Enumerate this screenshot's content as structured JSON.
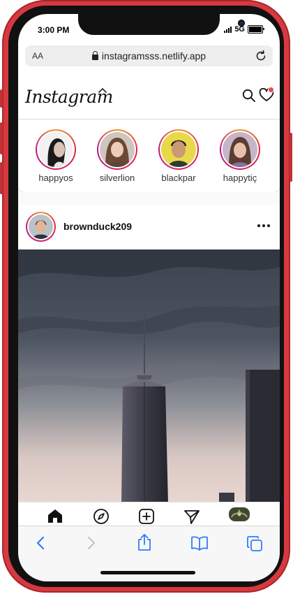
{
  "status_bar": {
    "time": "3:00 PM",
    "network": "5G"
  },
  "browser": {
    "text_size_label": "AA",
    "url": "instagramsss.netlify.app"
  },
  "header": {
    "logo_text": "Instagram"
  },
  "stories": [
    {
      "username": "happyos"
    },
    {
      "username": "silverlion"
    },
    {
      "username": "blackpar"
    },
    {
      "username": "happytiç"
    }
  ],
  "post": {
    "username": "brownduck209"
  },
  "colors": {
    "phone_frame": "#d6393f",
    "story_ring_start": "#f09433",
    "story_ring_end": "#bc1888",
    "notification_dot": "#ed4956",
    "safari_accent": "#2f7ef6"
  },
  "icons": {
    "header": [
      "chevron-up-icon",
      "search-icon",
      "heart-icon"
    ],
    "ig_nav": [
      "home-icon",
      "explore-compass-icon",
      "new-post-icon",
      "direct-message-icon",
      "profile-avatar"
    ],
    "safari": [
      "back-icon",
      "forward-icon",
      "share-icon",
      "bookmarks-icon",
      "tabs-icon"
    ]
  }
}
